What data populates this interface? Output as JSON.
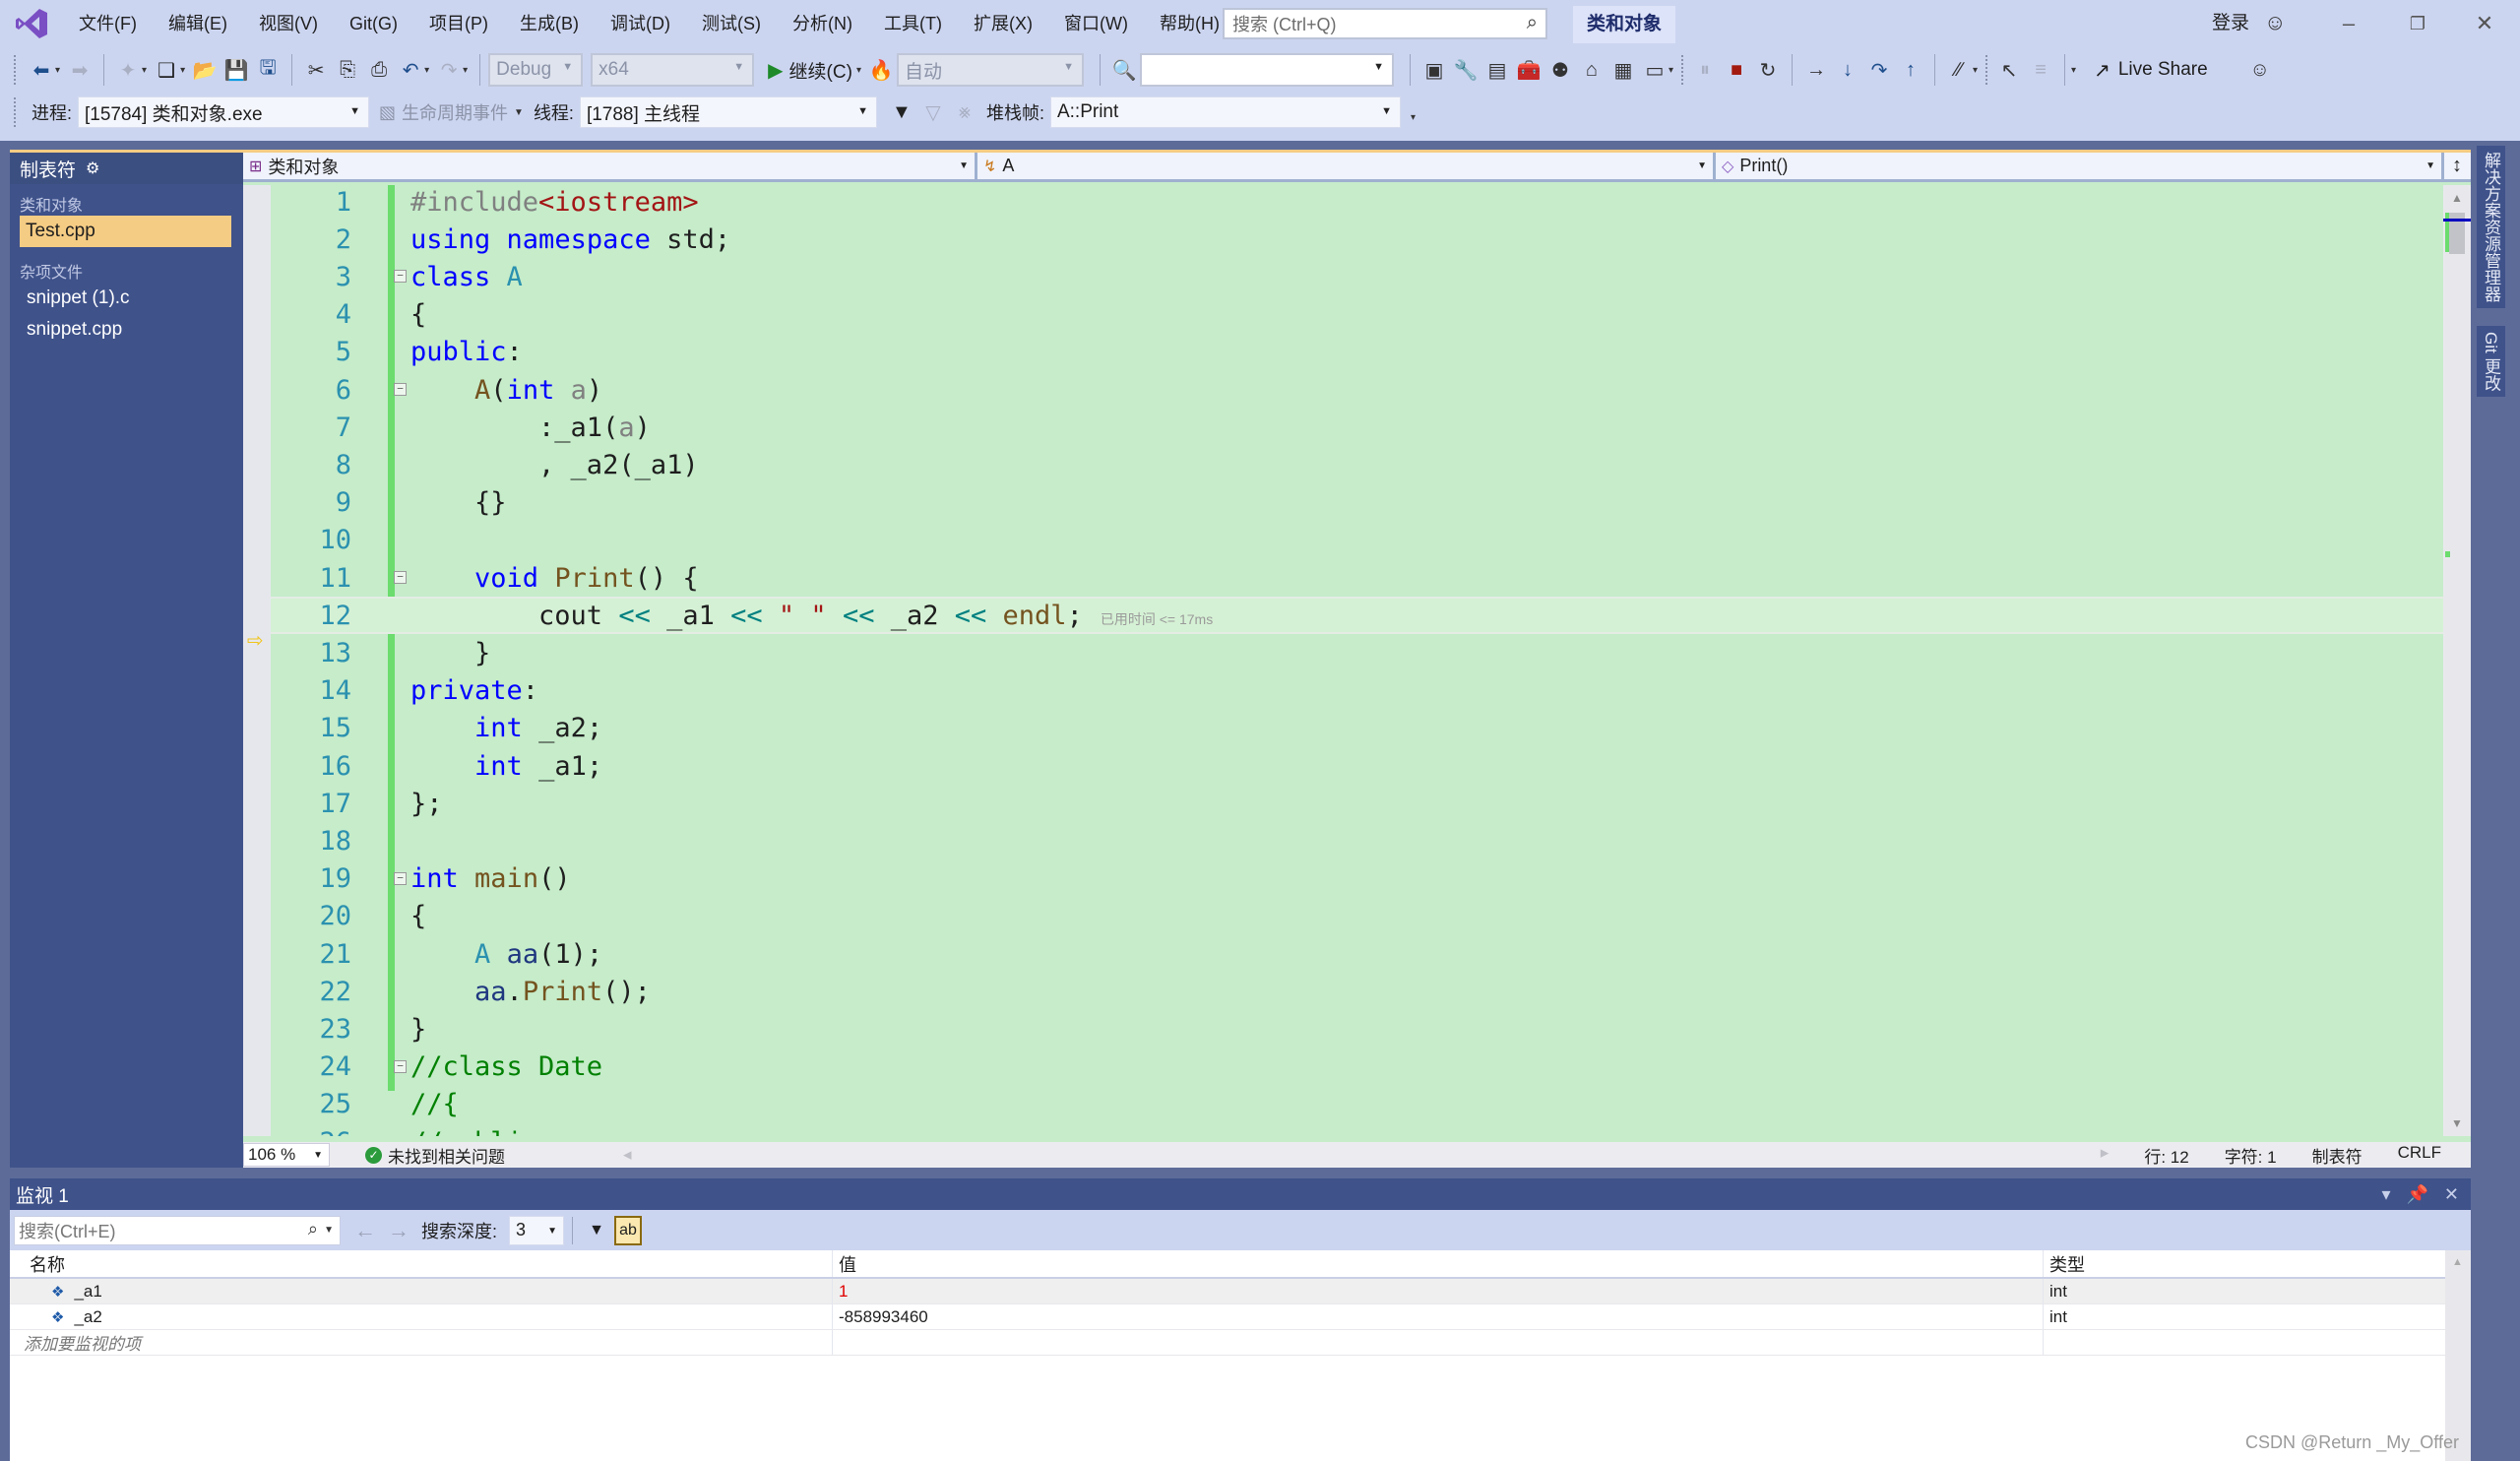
{
  "menubar": {
    "items": [
      "文件(F)",
      "编辑(E)",
      "视图(V)",
      "Git(G)",
      "项目(P)",
      "生成(B)",
      "调试(D)",
      "测试(S)",
      "分析(N)",
      "工具(T)",
      "扩展(X)",
      "窗口(W)",
      "帮助(H)"
    ],
    "search_placeholder": "搜索 (Ctrl+Q)",
    "solution_title": "类和对象",
    "login": "登录"
  },
  "toolbar": {
    "config": "Debug",
    "platform": "x64",
    "continue_label": "继续(C)",
    "auto_label": "自动",
    "live_share": "Live Share"
  },
  "debug_bar": {
    "process_label": "进程:",
    "process_value": "[15784] 类和对象.exe",
    "lifecycle_label": "生命周期事件",
    "thread_label": "线程:",
    "thread_value": "[1788] 主线程",
    "stackframe_label": "堆栈帧:",
    "stackframe_value": "A::Print"
  },
  "left_panel": {
    "title": "制表符",
    "groups": [
      {
        "name": "类和对象",
        "items": [
          {
            "label": "Test.cpp",
            "selected": true
          }
        ]
      },
      {
        "name": "杂项文件",
        "items": [
          {
            "label": "snippet (1).c",
            "selected": false
          },
          {
            "label": "snippet.cpp",
            "selected": false
          }
        ]
      }
    ]
  },
  "editor": {
    "nav_project": "类和对象",
    "nav_class": "A",
    "nav_member": "Print()",
    "current_line": 12,
    "perf_hint": "已用时间 <= 17ms",
    "lines": [
      "#include<iostream>",
      "using namespace std;",
      "class A",
      "{",
      "public:",
      "    A(int a)",
      "        :_a1(a)",
      "        , _a2(_a1)",
      "    {}",
      "",
      "    void Print() {",
      "        cout << _a1 << \" \" << _a2 << endl;",
      "    }",
      "private:",
      "    int _a2;",
      "    int _a1;",
      "};",
      "",
      "int main()",
      "{",
      "    A aa(1);",
      "    aa.Print();",
      "}",
      "//class Date",
      "//{",
      "//public:"
    ]
  },
  "status": {
    "zoom": "106 %",
    "issues": "未找到相关问题",
    "line": "行: 12",
    "char": "字符: 1",
    "indent": "制表符",
    "eol": "CRLF"
  },
  "right_tabs": [
    "解决方案资源管理器",
    "Git 更改"
  ],
  "watch": {
    "title": "监视 1",
    "search_placeholder": "搜索(Ctrl+E)",
    "depth_label": "搜索深度:",
    "depth_value": "3",
    "columns": [
      "名称",
      "值",
      "类型"
    ],
    "rows": [
      {
        "name": "_a1",
        "value": "1",
        "type": "int",
        "changed": true
      },
      {
        "name": "_a2",
        "value": "-858993460",
        "type": "int",
        "changed": false
      }
    ],
    "add_placeholder": "添加要监视的项"
  },
  "watermark": "CSDN @Return _My_Offer"
}
